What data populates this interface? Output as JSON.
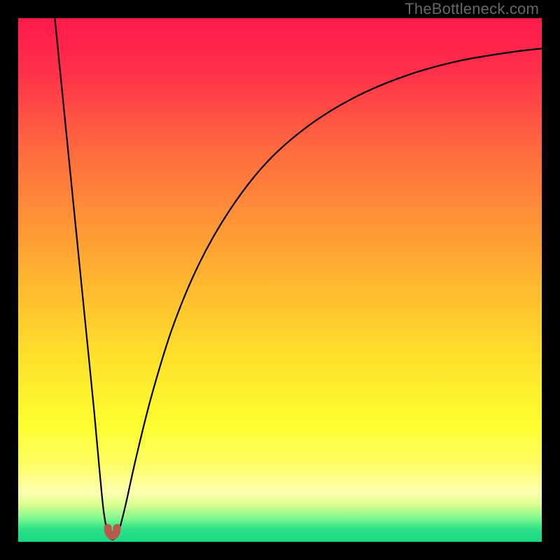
{
  "watermark": {
    "text": "TheBottleneck.com"
  },
  "chart_data": {
    "type": "line",
    "title": "",
    "xlabel": "",
    "ylabel": "",
    "xlim": [
      0,
      100
    ],
    "ylim": [
      0,
      100
    ],
    "grid": false,
    "legend": false,
    "background": {
      "kind": "vertical-gradient",
      "stops": [
        {
          "pos": 0.0,
          "color": "#ff1a4b"
        },
        {
          "pos": 0.1,
          "color": "#ff2f4a"
        },
        {
          "pos": 0.25,
          "color": "#ff6a3f"
        },
        {
          "pos": 0.45,
          "color": "#ffa733"
        },
        {
          "pos": 0.65,
          "color": "#ffe22a"
        },
        {
          "pos": 0.78,
          "color": "#fdff30"
        },
        {
          "pos": 0.855,
          "color": "#fdff68"
        },
        {
          "pos": 0.905,
          "color": "#feffb0"
        },
        {
          "pos": 0.93,
          "color": "#d9ff90"
        },
        {
          "pos": 0.955,
          "color": "#80f88e"
        },
        {
          "pos": 0.975,
          "color": "#30e287"
        },
        {
          "pos": 1.0,
          "color": "#17d884"
        }
      ]
    },
    "series": [
      {
        "name": "bottleneck-curve",
        "color": "#000000",
        "width": 2.2,
        "points": [
          {
            "x": 7.0,
            "y": 100.0
          },
          {
            "x": 8.5,
            "y": 85.0
          },
          {
            "x": 10.0,
            "y": 70.0
          },
          {
            "x": 11.5,
            "y": 55.0
          },
          {
            "x": 13.0,
            "y": 40.0
          },
          {
            "x": 14.5,
            "y": 25.0
          },
          {
            "x": 15.5,
            "y": 14.0
          },
          {
            "x": 16.3,
            "y": 6.0
          },
          {
            "x": 17.0,
            "y": 2.0
          },
          {
            "x": 17.6,
            "y": 0.6
          },
          {
            "x": 18.4,
            "y": 0.6
          },
          {
            "x": 19.2,
            "y": 2.0
          },
          {
            "x": 20.5,
            "y": 7.0
          },
          {
            "x": 22.5,
            "y": 16.0
          },
          {
            "x": 25.5,
            "y": 28.0
          },
          {
            "x": 29.5,
            "y": 41.0
          },
          {
            "x": 34.5,
            "y": 53.0
          },
          {
            "x": 40.5,
            "y": 63.5
          },
          {
            "x": 47.5,
            "y": 72.5
          },
          {
            "x": 55.5,
            "y": 79.5
          },
          {
            "x": 64.5,
            "y": 85.0
          },
          {
            "x": 74.0,
            "y": 89.0
          },
          {
            "x": 84.0,
            "y": 91.8
          },
          {
            "x": 94.0,
            "y": 93.5
          },
          {
            "x": 100.0,
            "y": 94.2
          }
        ]
      }
    ],
    "markers": [
      {
        "name": "minimum-marker",
        "shape": "u-notch",
        "x": 18.0,
        "y": 1.8,
        "color": "#b85a4a",
        "size": 20
      }
    ]
  }
}
